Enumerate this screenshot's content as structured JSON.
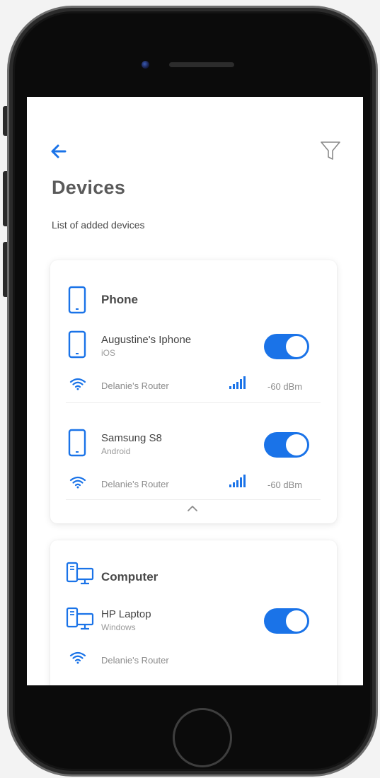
{
  "header": {
    "title": "Devices",
    "subtitle": "List of added devices",
    "back_icon": "arrow-left-icon",
    "filter_icon": "filter-funnel-icon"
  },
  "colors": {
    "accent": "#1a73e8",
    "title": "#5a5a5a",
    "muted": "#8c8c8c"
  },
  "categories": [
    {
      "label": "Phone",
      "icon": "smartphone-icon",
      "expanded": true,
      "devices": [
        {
          "name": "Augustine's Iphone",
          "os": "iOS",
          "enabled": true,
          "router": "Delanie's Router",
          "signal": "-60 dBm"
        },
        {
          "name": "Samsung S8",
          "os": "Android",
          "enabled": true,
          "router": "Delanie's Router",
          "signal": "-60 dBm"
        }
      ]
    },
    {
      "label": "Computer",
      "icon": "desktop-computer-icon",
      "devices": [
        {
          "name": "HP Laptop",
          "os": "Windows",
          "enabled": true,
          "router": "Delanie's Router"
        }
      ]
    }
  ]
}
